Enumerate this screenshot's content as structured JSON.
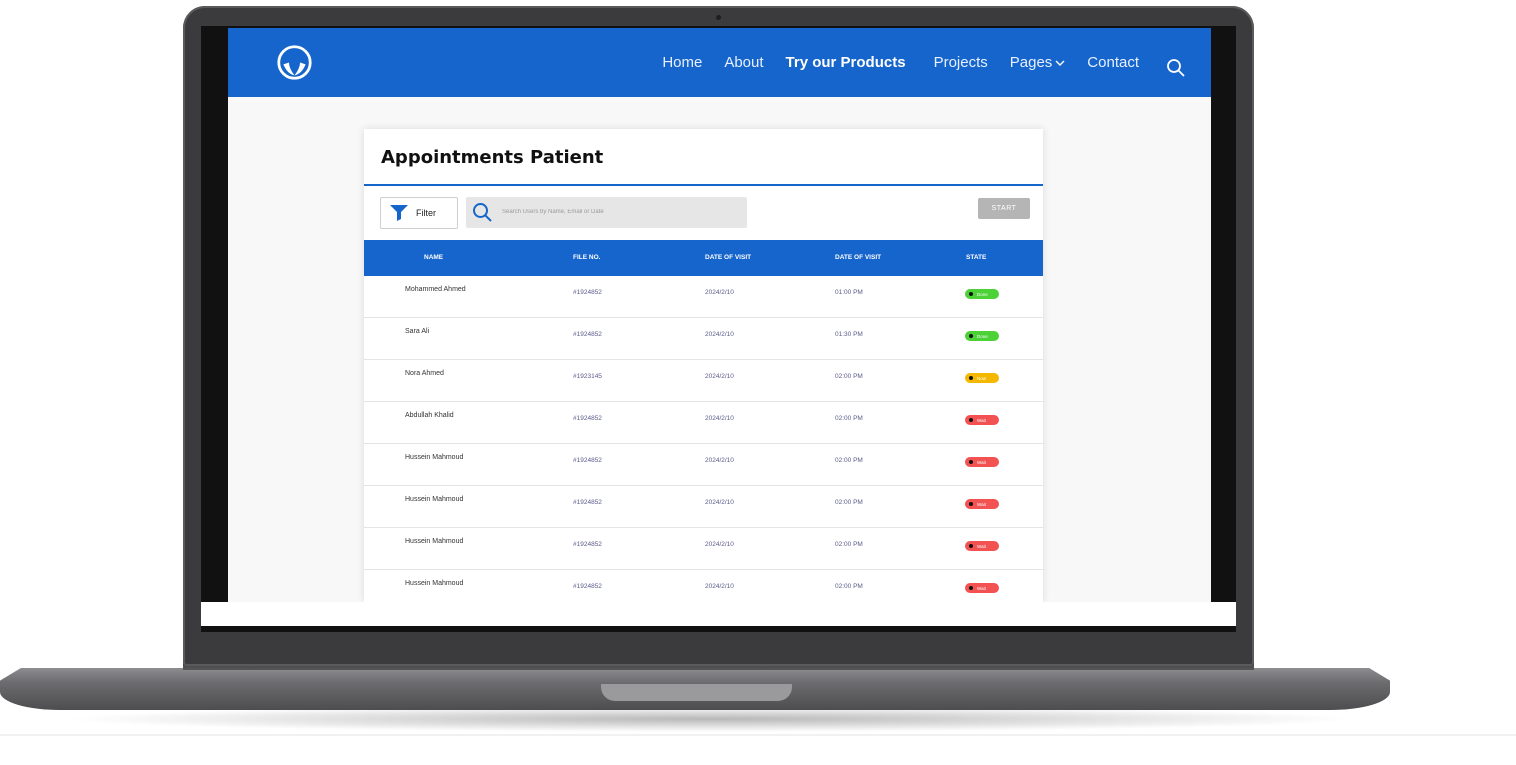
{
  "colors": {
    "brand_blue": "#1565cc",
    "done_green": "#4cd137",
    "now_amber": "#f5b800",
    "wait_red": "#f25252",
    "start_gray": "#b5b5b5"
  },
  "nav": {
    "items": [
      {
        "label": "Home",
        "active": false
      },
      {
        "label": "About",
        "active": false
      },
      {
        "label": "Try our  Products",
        "active": true
      },
      {
        "label": "Projects",
        "active": false
      },
      {
        "label": "Pages",
        "active": false,
        "dropdown": true
      },
      {
        "label": "Contact",
        "active": false
      }
    ],
    "search_icon": "search-icon",
    "logo_icon": "hands-logo-icon"
  },
  "card": {
    "title": "Appointments Patient",
    "filter_label": "Filter",
    "search_placeholder": "Search Users by Name, Email or Date",
    "start_label": "START"
  },
  "table": {
    "headers": [
      "NAME",
      "FILE NO.",
      "DATE OF VISIT",
      "DATE OF VISIT",
      "STATE"
    ],
    "rows": [
      {
        "name": "Mohammed Ahmed",
        "file": "#1924852",
        "date": "2024/2/10",
        "time": "01:00 PM",
        "state": "Done",
        "color": "#4cd137"
      },
      {
        "name": "Sara Ali",
        "file": "#1924852",
        "date": "2024/2/10",
        "time": "01:30 PM",
        "state": "Done",
        "color": "#4cd137"
      },
      {
        "name": "Nora Ahmed",
        "file": "#1923145",
        "date": "2024/2/10",
        "time": "02:00 PM",
        "state": "Now",
        "color": "#f5b800"
      },
      {
        "name": "Abdullah Khalid",
        "file": "#1924852",
        "date": "2024/2/10",
        "time": "02:00 PM",
        "state": "Wait",
        "color": "#f25252"
      },
      {
        "name": "Hussein Mahmoud",
        "file": "#1924852",
        "date": "2024/2/10",
        "time": "02:00 PM",
        "state": "Wait",
        "color": "#f25252"
      },
      {
        "name": "Hussein Mahmoud",
        "file": "#1924852",
        "date": "2024/2/10",
        "time": "02:00 PM",
        "state": "Wait",
        "color": "#f25252"
      },
      {
        "name": "Hussein Mahmoud",
        "file": "#1924852",
        "date": "2024/2/10",
        "time": "02:00 PM",
        "state": "Wait",
        "color": "#f25252"
      },
      {
        "name": "Hussein Mahmoud",
        "file": "#1924852",
        "date": "2024/2/10",
        "time": "02:00 PM",
        "state": "Wait",
        "color": "#f25252"
      }
    ]
  }
}
